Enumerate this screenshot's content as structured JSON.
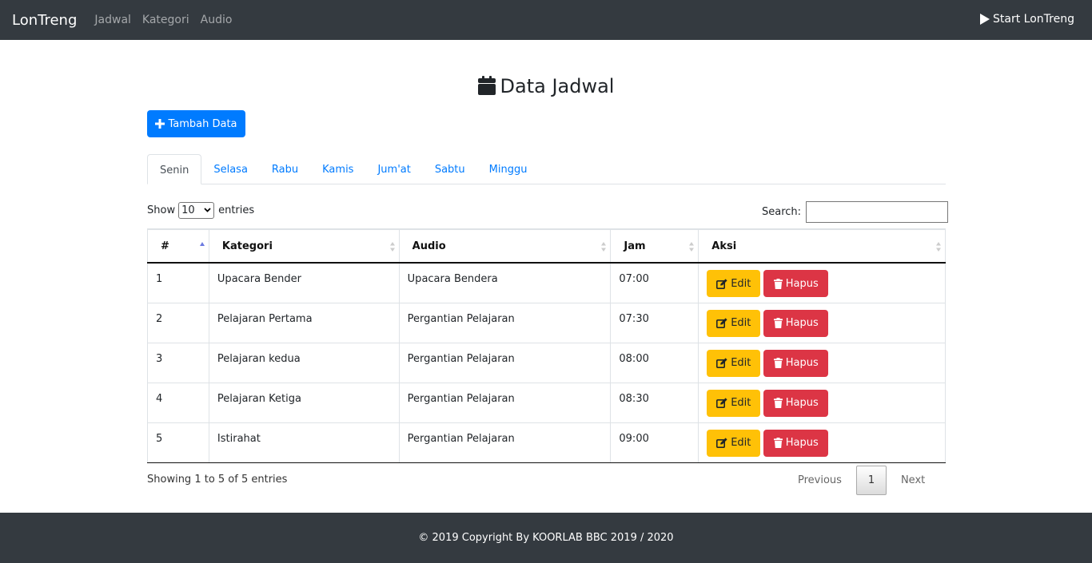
{
  "navbar": {
    "brand": "LonTreng",
    "links": [
      "Jadwal",
      "Kategori",
      "Audio"
    ],
    "start_label": "Start LonTreng"
  },
  "page": {
    "title": "Data Jadwal",
    "add_button": "Tambah Data"
  },
  "tabs": [
    "Senin",
    "Selasa",
    "Rabu",
    "Kamis",
    "Jum'at",
    "Sabtu",
    "Minggu"
  ],
  "active_tab": "Senin",
  "table_controls": {
    "show_label": "Show",
    "page_size": "10",
    "entries_label": "entries",
    "search_label": "Search:",
    "search_value": ""
  },
  "table": {
    "columns": [
      "#",
      "Kategori",
      "Audio",
      "Jam",
      "Aksi"
    ],
    "rows": [
      {
        "no": "1",
        "kategori": "Upacara Bender",
        "audio": "Upacara Bendera",
        "jam": "07:00"
      },
      {
        "no": "2",
        "kategori": "Pelajaran Pertama",
        "audio": "Pergantian Pelajaran",
        "jam": "07:30"
      },
      {
        "no": "3",
        "kategori": "Pelajaran kedua",
        "audio": "Pergantian Pelajaran",
        "jam": "08:00"
      },
      {
        "no": "4",
        "kategori": "Pelajaran Ketiga",
        "audio": "Pergantian Pelajaran",
        "jam": "08:30"
      },
      {
        "no": "5",
        "kategori": "Istirahat",
        "audio": "Pergantian Pelajaran",
        "jam": "09:00"
      }
    ],
    "edit_label": "Edit",
    "delete_label": "Hapus"
  },
  "pagination": {
    "info": "Showing 1 to 5 of 5 entries",
    "previous": "Previous",
    "current": "1",
    "next": "Next"
  },
  "footer": {
    "text": "© 2019 Copyright By KOORLAB BBC 2019 / 2020"
  },
  "colors": {
    "navbar": "#343a40",
    "primary": "#007bff",
    "warning": "#ffc107",
    "danger": "#dc3545"
  }
}
